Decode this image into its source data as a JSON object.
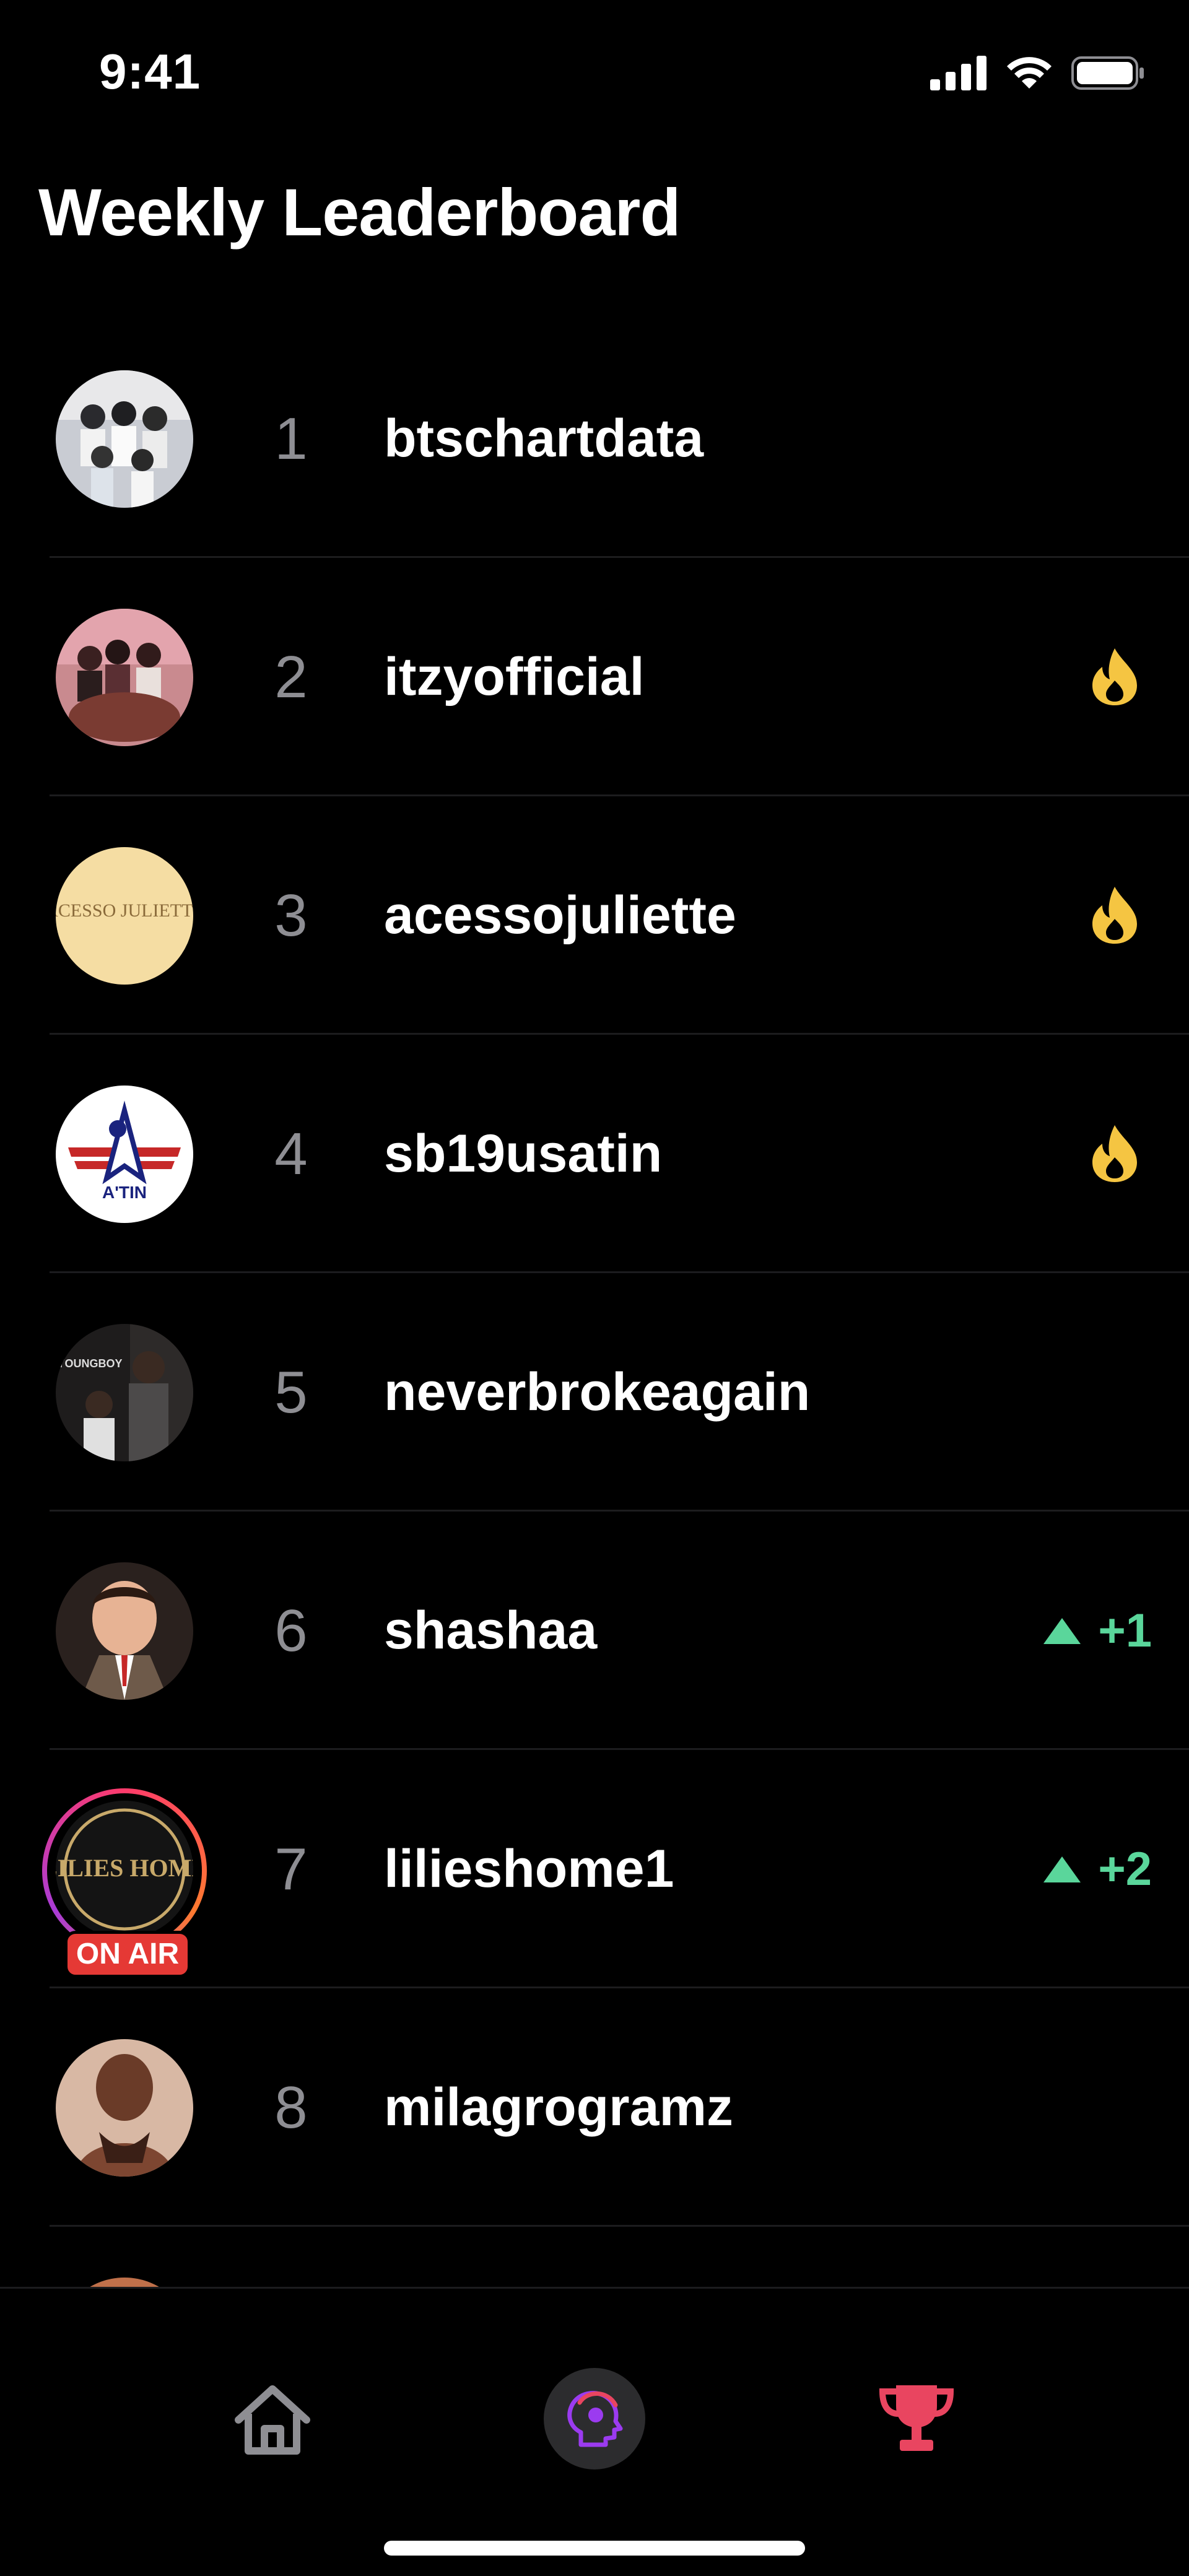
{
  "status": {
    "time": "9:41"
  },
  "header": {
    "title": "Weekly Leaderboard"
  },
  "leaderboard": [
    {
      "rank": "1",
      "username": "btschartdata",
      "badge": "none"
    },
    {
      "rank": "2",
      "username": "itzyofficial",
      "badge": "fire-icon"
    },
    {
      "rank": "3",
      "username": "acessojuliette",
      "badge": "fire-icon",
      "avatar_text": "ACESSO JULIETTE"
    },
    {
      "rank": "4",
      "username": "sb19usatin",
      "badge": "fire-icon",
      "avatar_text": "A'TIN"
    },
    {
      "rank": "5",
      "username": "neverbrokeagain",
      "badge": "none",
      "avatar_text": "YOUNGBOY"
    },
    {
      "rank": "6",
      "username": "shashaa",
      "badge": "rank-up",
      "change": "+1"
    },
    {
      "rank": "7",
      "username": "lilieshome1",
      "badge": "rank-up",
      "change": "+2",
      "live": "ON AIR",
      "avatar_text": "LILIES HOME"
    },
    {
      "rank": "8",
      "username": "milagrogramz",
      "badge": "none"
    }
  ],
  "tabs": [
    {
      "name": "home-icon",
      "active": false
    },
    {
      "name": "listening-head-icon",
      "active": false
    },
    {
      "name": "trophy-icon",
      "active": true
    }
  ],
  "colors": {
    "accent": "#e94560",
    "fire": "#f5c542",
    "rank_up": "#5ad69b",
    "live": "#e53935",
    "divider": "#1c1c1e"
  }
}
